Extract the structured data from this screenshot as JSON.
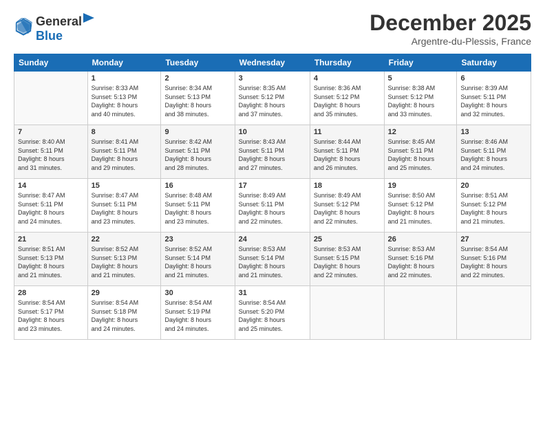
{
  "logo": {
    "general": "General",
    "blue": "Blue"
  },
  "header": {
    "title": "December 2025",
    "subtitle": "Argentre-du-Plessis, France"
  },
  "weekdays": [
    "Sunday",
    "Monday",
    "Tuesday",
    "Wednesday",
    "Thursday",
    "Friday",
    "Saturday"
  ],
  "weeks": [
    [
      {
        "day": "",
        "empty": true
      },
      {
        "day": "1",
        "sunrise": "Sunrise: 8:33 AM",
        "sunset": "Sunset: 5:13 PM",
        "daylight": "Daylight: 8 hours and 40 minutes."
      },
      {
        "day": "2",
        "sunrise": "Sunrise: 8:34 AM",
        "sunset": "Sunset: 5:13 PM",
        "daylight": "Daylight: 8 hours and 38 minutes."
      },
      {
        "day": "3",
        "sunrise": "Sunrise: 8:35 AM",
        "sunset": "Sunset: 5:12 PM",
        "daylight": "Daylight: 8 hours and 37 minutes."
      },
      {
        "day": "4",
        "sunrise": "Sunrise: 8:36 AM",
        "sunset": "Sunset: 5:12 PM",
        "daylight": "Daylight: 8 hours and 35 minutes."
      },
      {
        "day": "5",
        "sunrise": "Sunrise: 8:38 AM",
        "sunset": "Sunset: 5:12 PM",
        "daylight": "Daylight: 8 hours and 33 minutes."
      },
      {
        "day": "6",
        "sunrise": "Sunrise: 8:39 AM",
        "sunset": "Sunset: 5:11 PM",
        "daylight": "Daylight: 8 hours and 32 minutes."
      }
    ],
    [
      {
        "day": "7",
        "sunrise": "Sunrise: 8:40 AM",
        "sunset": "Sunset: 5:11 PM",
        "daylight": "Daylight: 8 hours and 31 minutes."
      },
      {
        "day": "8",
        "sunrise": "Sunrise: 8:41 AM",
        "sunset": "Sunset: 5:11 PM",
        "daylight": "Daylight: 8 hours and 29 minutes."
      },
      {
        "day": "9",
        "sunrise": "Sunrise: 8:42 AM",
        "sunset": "Sunset: 5:11 PM",
        "daylight": "Daylight: 8 hours and 28 minutes."
      },
      {
        "day": "10",
        "sunrise": "Sunrise: 8:43 AM",
        "sunset": "Sunset: 5:11 PM",
        "daylight": "Daylight: 8 hours and 27 minutes."
      },
      {
        "day": "11",
        "sunrise": "Sunrise: 8:44 AM",
        "sunset": "Sunset: 5:11 PM",
        "daylight": "Daylight: 8 hours and 26 minutes."
      },
      {
        "day": "12",
        "sunrise": "Sunrise: 8:45 AM",
        "sunset": "Sunset: 5:11 PM",
        "daylight": "Daylight: 8 hours and 25 minutes."
      },
      {
        "day": "13",
        "sunrise": "Sunrise: 8:46 AM",
        "sunset": "Sunset: 5:11 PM",
        "daylight": "Daylight: 8 hours and 24 minutes."
      }
    ],
    [
      {
        "day": "14",
        "sunrise": "Sunrise: 8:47 AM",
        "sunset": "Sunset: 5:11 PM",
        "daylight": "Daylight: 8 hours and 24 minutes."
      },
      {
        "day": "15",
        "sunrise": "Sunrise: 8:47 AM",
        "sunset": "Sunset: 5:11 PM",
        "daylight": "Daylight: 8 hours and 23 minutes."
      },
      {
        "day": "16",
        "sunrise": "Sunrise: 8:48 AM",
        "sunset": "Sunset: 5:11 PM",
        "daylight": "Daylight: 8 hours and 23 minutes."
      },
      {
        "day": "17",
        "sunrise": "Sunrise: 8:49 AM",
        "sunset": "Sunset: 5:11 PM",
        "daylight": "Daylight: 8 hours and 22 minutes."
      },
      {
        "day": "18",
        "sunrise": "Sunrise: 8:49 AM",
        "sunset": "Sunset: 5:12 PM",
        "daylight": "Daylight: 8 hours and 22 minutes."
      },
      {
        "day": "19",
        "sunrise": "Sunrise: 8:50 AM",
        "sunset": "Sunset: 5:12 PM",
        "daylight": "Daylight: 8 hours and 21 minutes."
      },
      {
        "day": "20",
        "sunrise": "Sunrise: 8:51 AM",
        "sunset": "Sunset: 5:12 PM",
        "daylight": "Daylight: 8 hours and 21 minutes."
      }
    ],
    [
      {
        "day": "21",
        "sunrise": "Sunrise: 8:51 AM",
        "sunset": "Sunset: 5:13 PM",
        "daylight": "Daylight: 8 hours and 21 minutes."
      },
      {
        "day": "22",
        "sunrise": "Sunrise: 8:52 AM",
        "sunset": "Sunset: 5:13 PM",
        "daylight": "Daylight: 8 hours and 21 minutes."
      },
      {
        "day": "23",
        "sunrise": "Sunrise: 8:52 AM",
        "sunset": "Sunset: 5:14 PM",
        "daylight": "Daylight: 8 hours and 21 minutes."
      },
      {
        "day": "24",
        "sunrise": "Sunrise: 8:53 AM",
        "sunset": "Sunset: 5:14 PM",
        "daylight": "Daylight: 8 hours and 21 minutes."
      },
      {
        "day": "25",
        "sunrise": "Sunrise: 8:53 AM",
        "sunset": "Sunset: 5:15 PM",
        "daylight": "Daylight: 8 hours and 22 minutes."
      },
      {
        "day": "26",
        "sunrise": "Sunrise: 8:53 AM",
        "sunset": "Sunset: 5:16 PM",
        "daylight": "Daylight: 8 hours and 22 minutes."
      },
      {
        "day": "27",
        "sunrise": "Sunrise: 8:54 AM",
        "sunset": "Sunset: 5:16 PM",
        "daylight": "Daylight: 8 hours and 22 minutes."
      }
    ],
    [
      {
        "day": "28",
        "sunrise": "Sunrise: 8:54 AM",
        "sunset": "Sunset: 5:17 PM",
        "daylight": "Daylight: 8 hours and 23 minutes."
      },
      {
        "day": "29",
        "sunrise": "Sunrise: 8:54 AM",
        "sunset": "Sunset: 5:18 PM",
        "daylight": "Daylight: 8 hours and 24 minutes."
      },
      {
        "day": "30",
        "sunrise": "Sunrise: 8:54 AM",
        "sunset": "Sunset: 5:19 PM",
        "daylight": "Daylight: 8 hours and 24 minutes."
      },
      {
        "day": "31",
        "sunrise": "Sunrise: 8:54 AM",
        "sunset": "Sunset: 5:20 PM",
        "daylight": "Daylight: 8 hours and 25 minutes."
      },
      {
        "day": "",
        "empty": true
      },
      {
        "day": "",
        "empty": true
      },
      {
        "day": "",
        "empty": true
      }
    ]
  ]
}
